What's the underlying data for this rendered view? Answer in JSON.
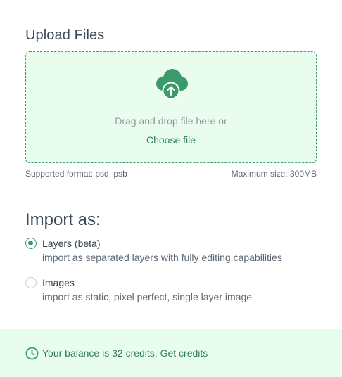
{
  "upload": {
    "title": "Upload Files",
    "drop_text": "Drag and drop file here or",
    "choose_file_label": "Choose file",
    "supported_format": "Supported format: psd, psb",
    "max_size": "Maximum size: 300MB",
    "icon": "cloud-upload-icon"
  },
  "import": {
    "heading": "Import as:",
    "options": [
      {
        "label": "Layers (beta)",
        "description": "import as separated layers with fully editing capabilities",
        "selected": true
      },
      {
        "label": "Images",
        "description": "import as static, pixel perfect, single layer image",
        "selected": false
      }
    ]
  },
  "balance": {
    "text": "Your balance is 32 credits, ",
    "link_label": "Get credits",
    "icon": "clock-icon"
  },
  "colors": {
    "accent": "#3a9a6c",
    "accent_dark": "#2f7d5b",
    "dropzone_bg": "#e8fdee"
  }
}
